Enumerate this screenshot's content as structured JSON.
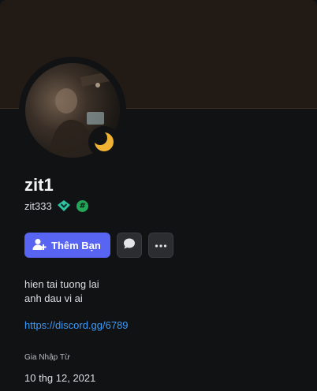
{
  "profile": {
    "display_name": "zit1",
    "username": "zit333",
    "status": "idle",
    "bio_lines": [
      "hien tai tuong lai",
      "anh dau vi ai"
    ],
    "link": "https://discord.gg/6789",
    "member_since_label": "Gia Nhập Từ",
    "member_since": "10 thg 12, 2021"
  },
  "badges": [
    {
      "icon": "hypesquad-badge-icon"
    },
    {
      "icon": "hash-badge-icon",
      "glyph": "#"
    }
  ],
  "actions": {
    "add_friend_label": "Thêm Bạn",
    "message_icon": "chat-bubble-icon",
    "more_icon": "more-dots-icon"
  },
  "colors": {
    "background": "#111214",
    "banner": "#221a14",
    "accent": "#5865f2",
    "idle": "#f0b232",
    "link": "#3b9bfb",
    "badge_green": "#23a55a"
  }
}
